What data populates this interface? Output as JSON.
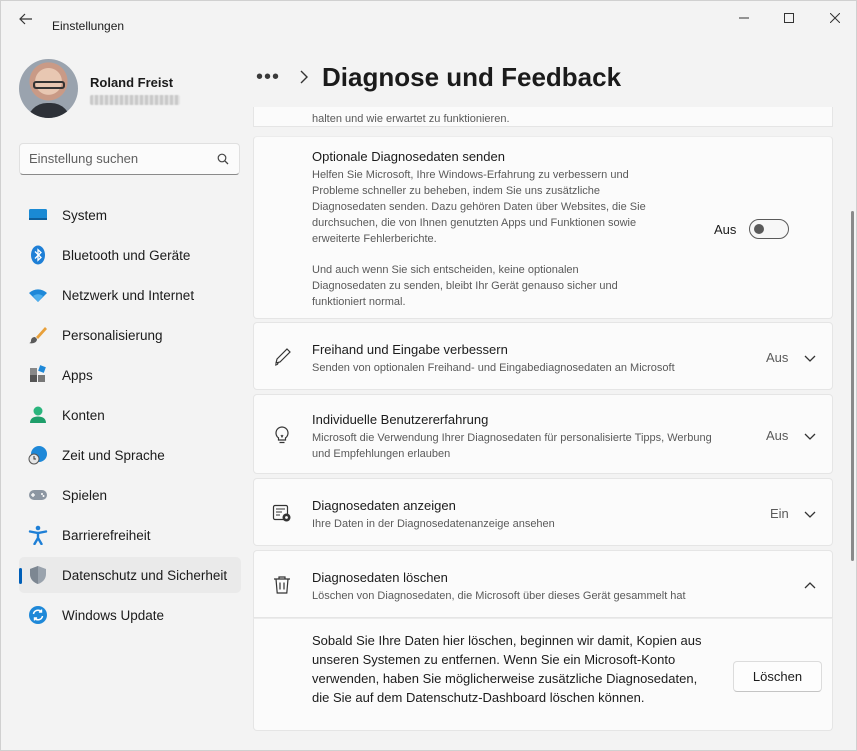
{
  "window": {
    "title": "Einstellungen"
  },
  "profile": {
    "name": "Roland Freist"
  },
  "search": {
    "placeholder": "Einstellung suchen"
  },
  "sidebar": {
    "items": [
      {
        "label": "System",
        "icon": "monitor-icon"
      },
      {
        "label": "Bluetooth und Geräte",
        "icon": "bluetooth-icon"
      },
      {
        "label": "Netzwerk und Internet",
        "icon": "wifi-icon"
      },
      {
        "label": "Personalisierung",
        "icon": "brush-icon"
      },
      {
        "label": "Apps",
        "icon": "apps-icon"
      },
      {
        "label": "Konten",
        "icon": "user-icon"
      },
      {
        "label": "Zeit und Sprache",
        "icon": "globe-clock-icon"
      },
      {
        "label": "Spielen",
        "icon": "gamepad-icon"
      },
      {
        "label": "Barrierefreiheit",
        "icon": "accessibility-icon"
      },
      {
        "label": "Datenschutz und Sicherheit",
        "icon": "shield-icon",
        "active": true
      },
      {
        "label": "Windows Update",
        "icon": "update-icon"
      }
    ]
  },
  "header": {
    "more": "•••",
    "title": "Diagnose und Feedback"
  },
  "main": {
    "partial_text": "halten und wie erwartet zu funktionieren.",
    "optional": {
      "title": "Optionale Diagnosedaten senden",
      "desc1": "Helfen Sie Microsoft, Ihre Windows-Erfahrung zu verbessern und Probleme schneller zu beheben, indem Sie uns zusätzliche Diagnosedaten senden. Dazu gehören Daten über Websites, die Sie durchsuchen, die von Ihnen genutzten Apps und Funktionen sowie erweiterte Fehlerberichte.",
      "desc2": "Und auch wenn Sie sich entscheiden, keine optionalen Diagnosedaten zu senden, bleibt Ihr Gerät genauso sicher und funktioniert normal.",
      "toggle_label": "Aus"
    },
    "ink": {
      "title": "Freihand und Eingabe verbessern",
      "desc": "Senden von optionalen Freihand- und Eingabediagnosedaten an Microsoft",
      "state": "Aus"
    },
    "tailored": {
      "title": "Individuelle Benutzererfahrung",
      "desc": "Microsoft die Verwendung Ihrer Diagnosedaten für personalisierte Tipps, Werbung und Empfehlungen erlauben",
      "state": "Aus"
    },
    "viewer": {
      "title": "Diagnosedaten anzeigen",
      "desc": "Ihre Daten in der Diagnosedatenanzeige ansehen",
      "state": "Ein"
    },
    "delete": {
      "title": "Diagnosedaten löschen",
      "desc": "Löschen von Diagnosedaten, die Microsoft über dieses Gerät gesammelt hat",
      "body": "Sobald Sie Ihre Daten hier löschen, beginnen wir damit, Kopien aus unseren Systemen zu entfernen. Wenn Sie ein Microsoft-Konto verwenden, haben Sie möglicherweise zusätzliche Diagnosedaten, die Sie auf dem Datenschutz-Dashboard löschen können.",
      "button": "Löschen"
    }
  },
  "colors": {
    "accent": "#005fb8",
    "background": "#f3f3f3",
    "card": "#fbfbfb"
  }
}
